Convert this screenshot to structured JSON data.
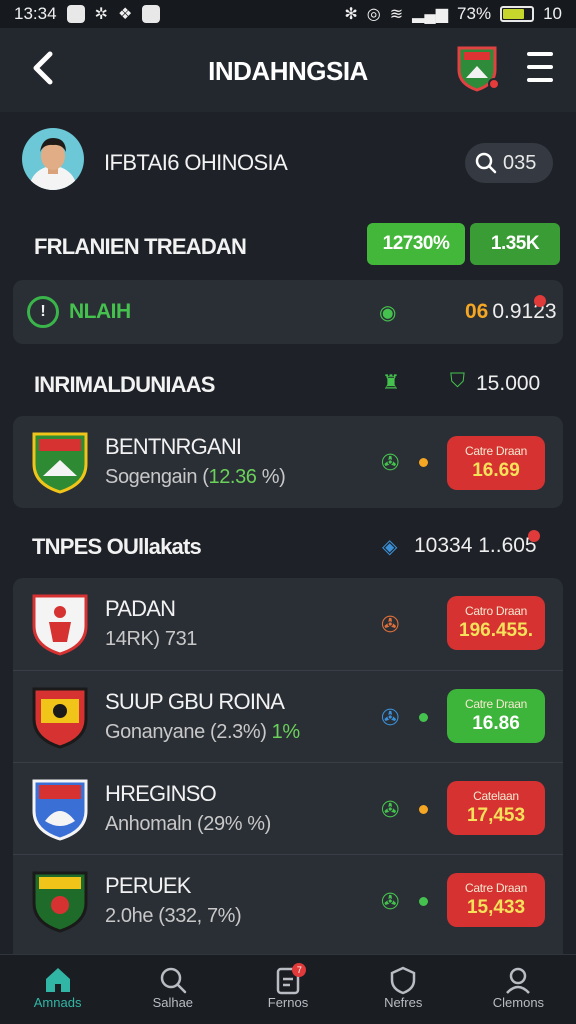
{
  "status_bar": {
    "time": "13:34",
    "battery_pct": "73%",
    "signal_extra": "10",
    "battery_level": 0.73
  },
  "header": {
    "title": "INDAHNGSIA"
  },
  "profile": {
    "name": "IFBTAI6 OHINOSIA",
    "search_value": "035"
  },
  "section1": {
    "title": "FRLANIEN TREADAN",
    "pill1": "12730%",
    "pill2": "1.35K"
  },
  "status_card": {
    "live_label": "NLAIH",
    "value_prefix": "06",
    "value": "0.9123"
  },
  "section2": {
    "title": "INRIMALDUNIAAS",
    "value": "15.000"
  },
  "featured": {
    "name": "BENTNRGANI",
    "sub_prefix": "Sogengain (",
    "sub_highlight": "12.36",
    "sub_suffix": " %)",
    "odds_label": "Catre Draan",
    "odds_value": "16.69"
  },
  "section3": {
    "title": "TNPES OUllakats",
    "value": "10334 1..605"
  },
  "teams": [
    {
      "name": "PADAN",
      "sub": "14RK) 731",
      "odds_label": "Catro Draan",
      "odds_value": "196.455.",
      "odds_color": "red"
    },
    {
      "name": "SUUP GBU ROINA",
      "sub": "Gonanyane (2.3%)",
      "sub_extra": "1%",
      "odds_label": "Catre Draan",
      "odds_value": "16.86",
      "odds_color": "green"
    },
    {
      "name": "HREGINSO",
      "sub": "Anhomaln (29% %)",
      "odds_label": "Catelaan",
      "odds_value": "17,453",
      "odds_color": "red"
    },
    {
      "name": "PERUEK",
      "sub": "2.0he (332, 7%)",
      "odds_label": "Catre Draan",
      "odds_value": "15,433",
      "odds_color": "red"
    }
  ],
  "bottom_nav": [
    {
      "label": "Amnads",
      "icon": "home-icon"
    },
    {
      "label": "Salhae",
      "icon": "search-icon"
    },
    {
      "label": "Fernos",
      "icon": "clipboard-icon",
      "badge": "7"
    },
    {
      "label": "Nefres",
      "icon": "shield-icon"
    },
    {
      "label": "Clemons",
      "icon": "profile-icon"
    }
  ]
}
